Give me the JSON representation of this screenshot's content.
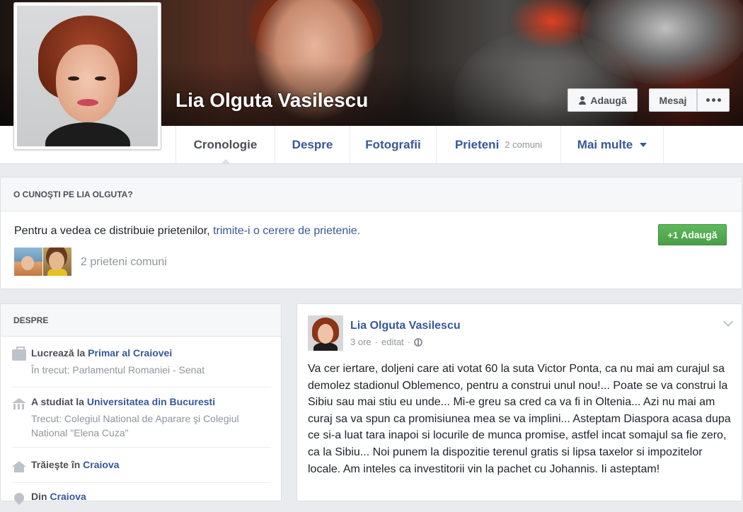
{
  "profile": {
    "name": "Lia Olguta Vasilescu"
  },
  "cover_actions": {
    "add_friend": "Adaugă",
    "message": "Mesaj"
  },
  "nav": {
    "tabs": [
      {
        "label": "Cronologie",
        "active": true
      },
      {
        "label": "Despre"
      },
      {
        "label": "Fotografii"
      },
      {
        "label": "Prieteni",
        "count": "2 comuni"
      },
      {
        "label": "Mai multe",
        "dropdown": true
      }
    ]
  },
  "know_card": {
    "heading": "O CUNOŞTI PE LIA OLGUTA?",
    "text_prefix": "Pentru a vedea ce distribuie prietenilor, ",
    "link_text": "trimite-i o cerere de prietenie.",
    "add_button": "Adaugă",
    "mutual_friends": "2 prieteni comuni"
  },
  "about": {
    "heading": "DESPRE",
    "items": [
      {
        "icon": "briefcase-icon",
        "prefix": "Lucrează la ",
        "link": "Primar al Craiovei",
        "sub": "În trecut: Parlamentul Romaniei - Senat"
      },
      {
        "icon": "school-icon",
        "prefix": "A studiat la ",
        "link": "Universitatea din Bucuresti",
        "sub": "Trecut: Colegiul National de Aparare şi Colegiul National \"Elena Cuza\""
      },
      {
        "icon": "home-icon",
        "prefix": "Trăieşte în ",
        "link": "Craiova"
      },
      {
        "icon": "pin-icon",
        "prefix": "Din ",
        "link": "Craiova"
      }
    ]
  },
  "post": {
    "author": "Lia Olguta Vasilescu",
    "time": "3 ore",
    "edited": "editat",
    "body": "Va cer iertare, doljeni care ati votat 60 la suta Victor Ponta, ca nu mai am curajul sa demolez stadionul Oblemenco, pentru a construi unul nou!... Poate se va construi la Sibiu sau mai stiu eu unde... Mi-e greu sa cred ca va fi in Oltenia... Azi nu mai am curaj sa va spun ca promisiunea mea se va implini... Asteptam Diaspora acasa dupa ce si-a luat tara inapoi si locurile de munca promise, astfel incat somajul sa fie zero, ca la Sibiu... Noi punem la dispozitie terenul gratis si lipsa taxelor si impozitelor locale. Am inteles ca investitorii vin la pachet cu Johannis. Ii asteptam!"
  }
}
